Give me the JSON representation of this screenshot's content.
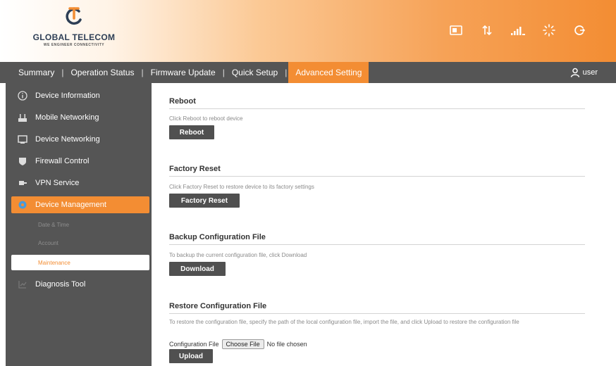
{
  "brand": {
    "name": "GLOBAL TELECOM",
    "tagline": "WE ENGINEER CONNECTIVITY",
    "accent_color": "#f38d33",
    "dark_color": "#555555"
  },
  "status_icons": [
    "sim-card-icon",
    "data-transfer-icon",
    "signal-strength-icon",
    "wifi-sun-icon",
    "power-icon"
  ],
  "nav": {
    "tabs": [
      {
        "label": "Summary"
      },
      {
        "label": "Operation Status"
      },
      {
        "label": "Firmware Update"
      },
      {
        "label": "Quick Setup"
      },
      {
        "label": "Advanced Setting",
        "active": true
      }
    ],
    "separator": "|",
    "user_label": "user"
  },
  "sidebar": {
    "items": [
      {
        "label": "Device Information",
        "icon": "info-icon"
      },
      {
        "label": "Mobile Networking",
        "icon": "network-icon"
      },
      {
        "label": "Device Networking",
        "icon": "monitor-icon"
      },
      {
        "label": "Firewall Control",
        "icon": "shield-icon"
      },
      {
        "label": "VPN Service",
        "icon": "vpn-icon"
      },
      {
        "label": "Device Management",
        "icon": "gear-icon",
        "active": true
      },
      {
        "label": "Diagnosis Tool",
        "icon": "chart-icon"
      }
    ],
    "sub_items": [
      {
        "label": "Date & Time"
      },
      {
        "label": "Account"
      },
      {
        "label": "Maintenance",
        "active": true
      }
    ]
  },
  "main": {
    "reboot": {
      "title": "Reboot",
      "desc": "Click Reboot to reboot device",
      "button": "Reboot"
    },
    "factory_reset": {
      "title": "Factory Reset",
      "desc": "Click Factory Reset to restore device to its factory settings",
      "button": "Factory Reset"
    },
    "backup": {
      "title": "Backup Configuration File",
      "desc": "To backup the current configuration file, click Download",
      "button": "Download"
    },
    "restore": {
      "title": "Restore Configuration File",
      "desc": "To restore the configuration file, specify the path of the local configuration file, import the file, and click Upload to restore the configuration file",
      "file_label": "Configuration File",
      "choose_button": "Choose File",
      "file_status": "No file chosen",
      "button": "Upload"
    }
  }
}
